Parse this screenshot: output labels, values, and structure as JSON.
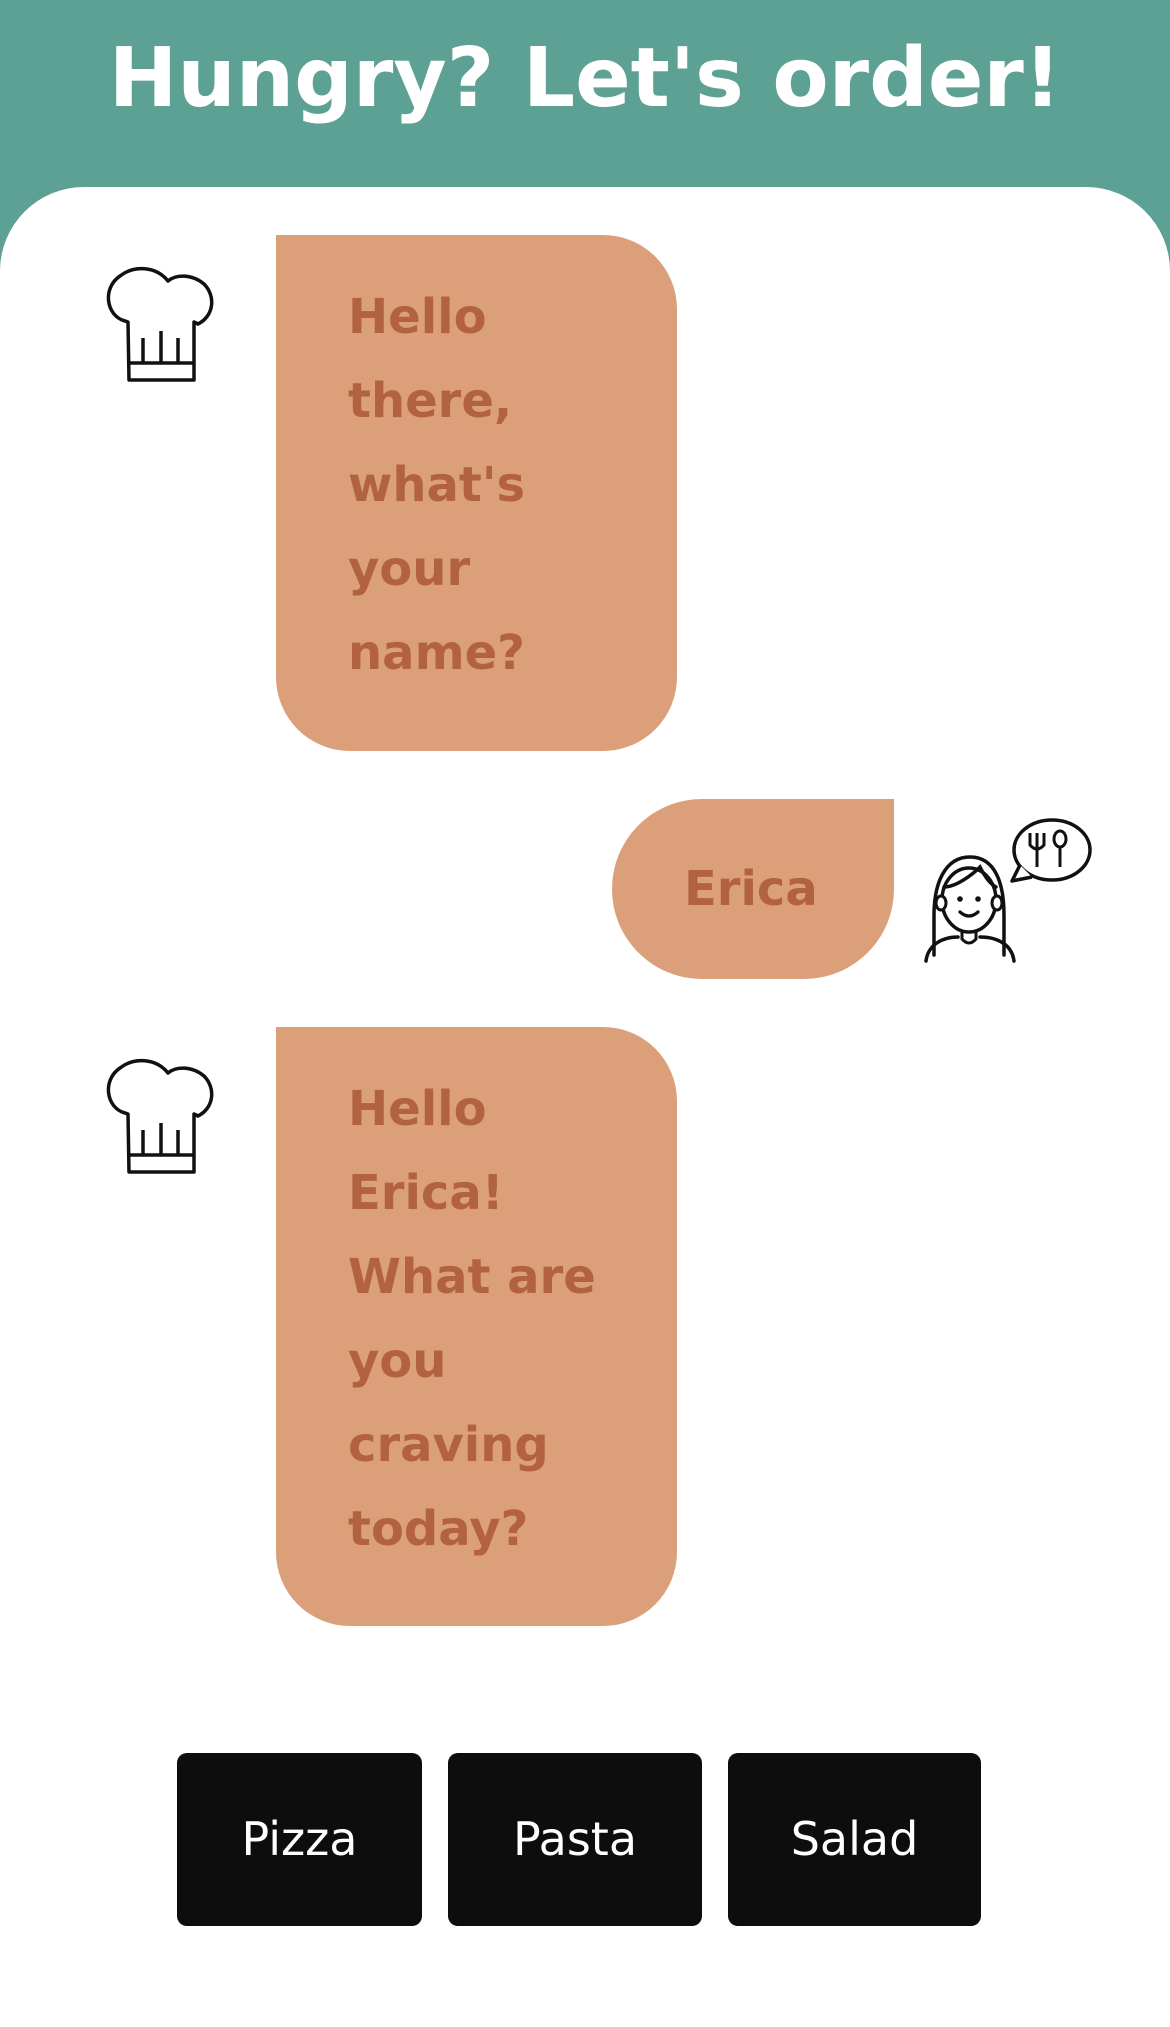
{
  "header": {
    "title": "Hungry? Let's order!"
  },
  "conversation": {
    "messages": [
      {
        "sender": "bot",
        "avatar_icon": "chef-hat-icon",
        "text": "Hello there, what's your name?"
      },
      {
        "sender": "user",
        "avatar_icon": "user-food-bubble-icon",
        "text": "Erica"
      },
      {
        "sender": "bot",
        "avatar_icon": "chef-hat-icon",
        "text": "Hello Erica! What are you craving today?"
      }
    ]
  },
  "choices": {
    "options": [
      {
        "label": "Pizza"
      },
      {
        "label": "Pasta"
      },
      {
        "label": "Salad"
      }
    ]
  },
  "colors": {
    "header_bg": "#5da194",
    "panel_bg": "#ffffff",
    "bubble_bg": "#dba079",
    "bubble_text": "#b26241",
    "button_bg": "#0d0d0d",
    "button_text": "#ffffff"
  }
}
